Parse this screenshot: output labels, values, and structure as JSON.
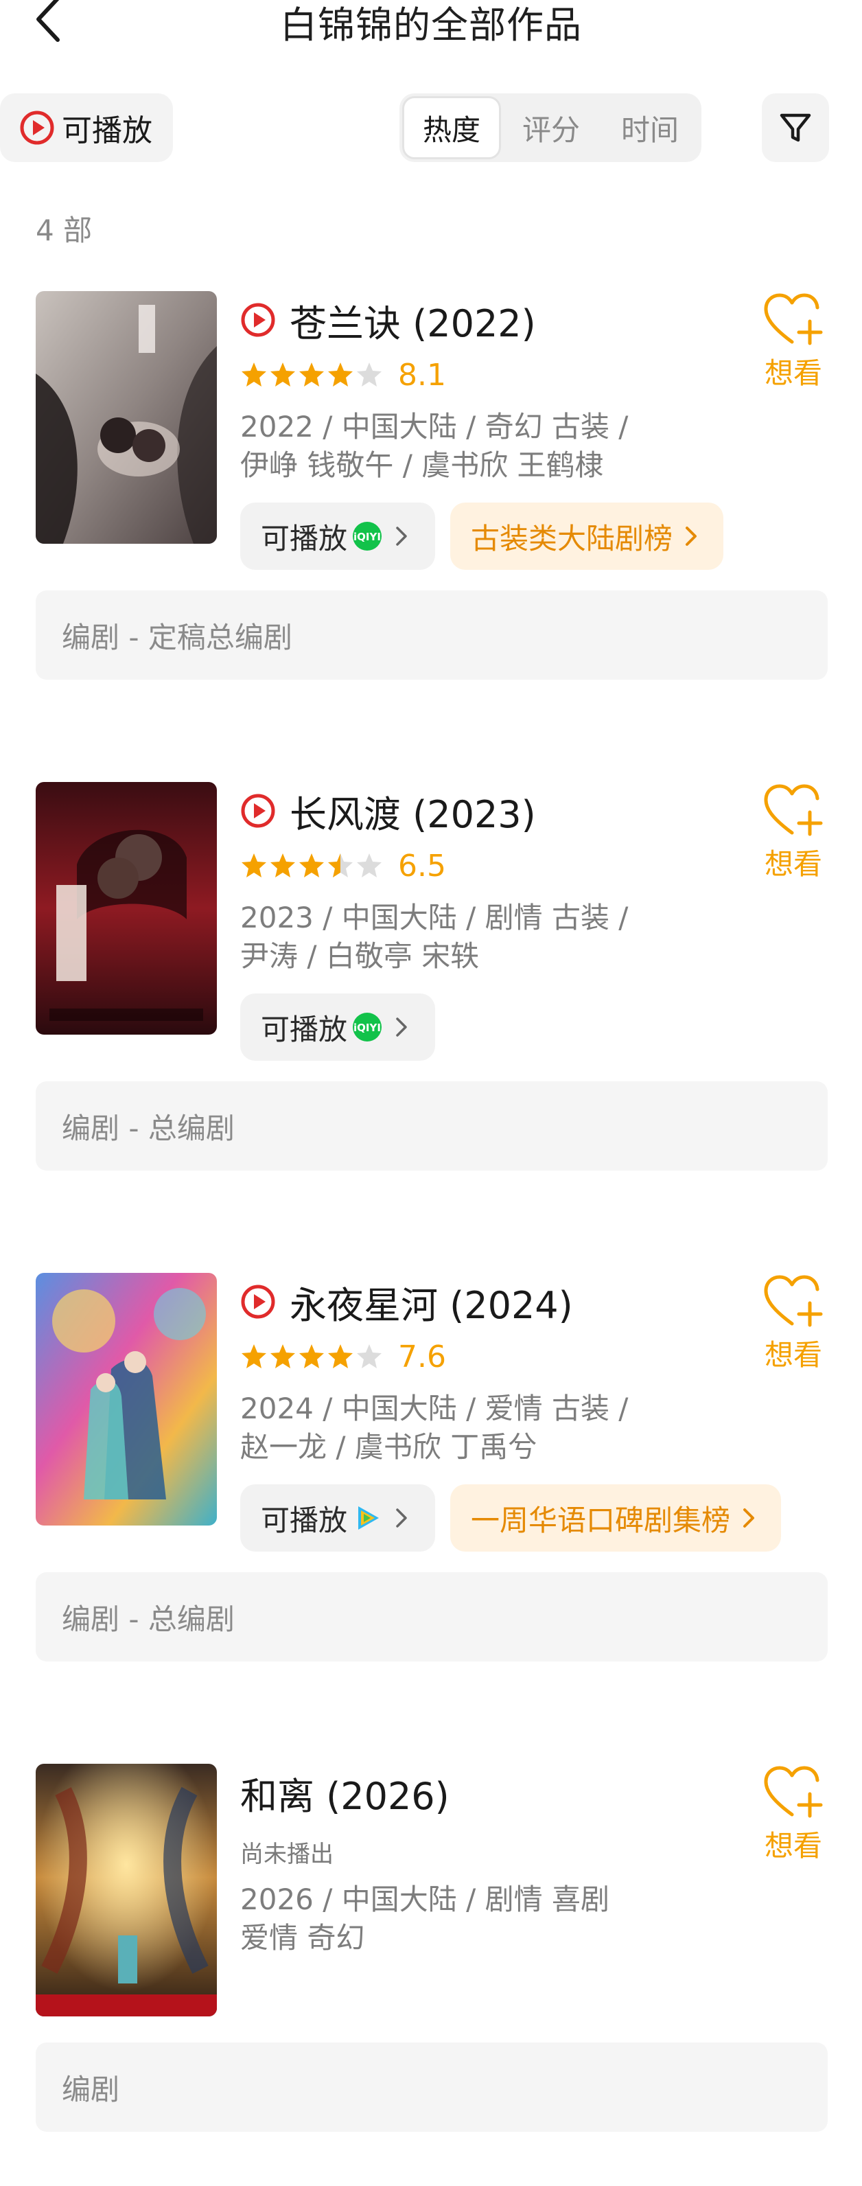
{
  "header": {
    "title": "白锦锦的全部作品"
  },
  "filter": {
    "playable_label": "可播放",
    "sort_options": [
      "热度",
      "评分",
      "时间"
    ],
    "selected_sort": "热度"
  },
  "count_label": "4 部",
  "want_label": "想看",
  "colors": {
    "accent": "#f5a100",
    "play_red": "#e02b2b",
    "rank_bg": "#fff2e0",
    "rank_text": "#e58a05"
  },
  "works": [
    {
      "title": "苍兰诀 (2022)",
      "playable": true,
      "rating": {
        "stars": 4,
        "score": "8.1"
      },
      "meta_line1": "2022 / 中国大陆 / 奇幻 古装 /",
      "meta_line2": "伊峥 钱敬午 / 虞书欣 王鹤棣",
      "play_label": "可播放",
      "platform": "iqiyi-icon",
      "rank_label": "古装类大陆剧榜",
      "role": "编剧 - 定稿总编剧"
    },
    {
      "title": "长风渡 (2023)",
      "playable": true,
      "rating": {
        "stars": 3.5,
        "score": "6.5"
      },
      "meta_line1": "2023 / 中国大陆 / 剧情 古装 /",
      "meta_line2": "尹涛 / 白敬亭 宋轶",
      "play_label": "可播放",
      "platform": "iqiyi-icon",
      "role": "编剧 - 总编剧"
    },
    {
      "title": "永夜星河 (2024)",
      "playable": true,
      "rating": {
        "stars": 4,
        "score": "7.6"
      },
      "meta_line1": "2024 / 中国大陆 / 爱情 古装 /",
      "meta_line2": "赵一龙 / 虞书欣 丁禹兮",
      "play_label": "可播放",
      "platform": "tencent-video-icon",
      "rank_label": "一周华语口碑剧集榜",
      "role": "编剧 - 总编剧"
    },
    {
      "title": "和离 (2026)",
      "playable": false,
      "status": "尚未播出",
      "meta_line1": "2026 / 中国大陆 / 剧情 喜剧",
      "meta_line2": "爱情 奇幻",
      "role": "编剧"
    }
  ]
}
